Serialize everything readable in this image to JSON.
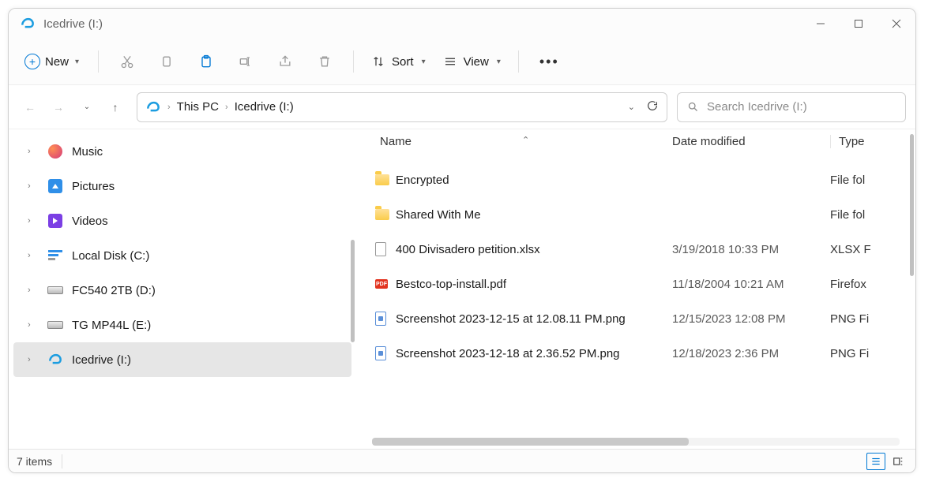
{
  "window": {
    "title": "Icedrive (I:)"
  },
  "toolbar": {
    "new_label": "New",
    "sort_label": "Sort",
    "view_label": "View"
  },
  "breadcrumb": {
    "parts": [
      "This PC",
      "Icedrive (I:)"
    ]
  },
  "search": {
    "placeholder": "Search Icedrive (I:)"
  },
  "sidebar": {
    "items": [
      {
        "label": "Music",
        "icon": "music"
      },
      {
        "label": "Pictures",
        "icon": "pictures"
      },
      {
        "label": "Videos",
        "icon": "videos"
      },
      {
        "label": "Local Disk (C:)",
        "icon": "localdisk"
      },
      {
        "label": "FC540 2TB (D:)",
        "icon": "drive"
      },
      {
        "label": "TG MP44L (E:)",
        "icon": "drive"
      },
      {
        "label": "Icedrive (I:)",
        "icon": "icedrive",
        "selected": true
      }
    ]
  },
  "columns": {
    "name": "Name",
    "date": "Date modified",
    "type": "Type"
  },
  "files": [
    {
      "icon": "folder",
      "name": "Encrypted",
      "date": "",
      "type": "File fol"
    },
    {
      "icon": "folder",
      "name": "Shared With Me",
      "date": "",
      "type": "File fol"
    },
    {
      "icon": "file",
      "name": "400 Divisadero petition.xlsx",
      "date": "3/19/2018 10:33 PM",
      "type": "XLSX F"
    },
    {
      "icon": "pdf",
      "name": "Bestco-top-install.pdf",
      "date": "11/18/2004 10:21 AM",
      "type": "Firefox"
    },
    {
      "icon": "png",
      "name": "Screenshot 2023-12-15 at 12.08.11 PM.png",
      "date": "12/15/2023 12:08 PM",
      "type": "PNG Fi"
    },
    {
      "icon": "png",
      "name": "Screenshot 2023-12-18 at 2.36.52 PM.png",
      "date": "12/18/2023 2:36 PM",
      "type": "PNG Fi"
    }
  ],
  "status": {
    "count": "7 items"
  }
}
